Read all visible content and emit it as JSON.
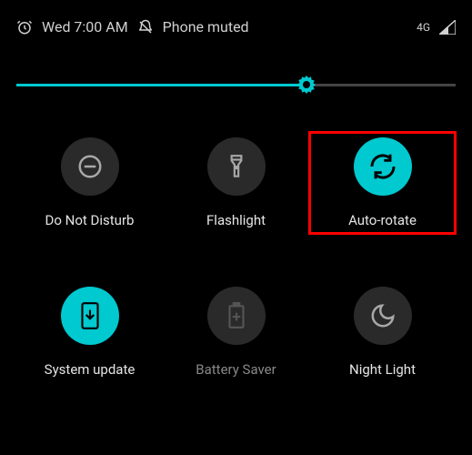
{
  "status": {
    "alarm_time": "Wed 7:00 AM",
    "mute_label": "Phone muted",
    "network": "4G"
  },
  "brightness": {
    "value_percent": 66
  },
  "tiles": [
    {
      "id": "dnd",
      "label": "Do Not Disturb",
      "active": false,
      "highlighted": false
    },
    {
      "id": "flashlight",
      "label": "Flashlight",
      "active": false,
      "highlighted": false
    },
    {
      "id": "auto-rotate",
      "label": "Auto-rotate",
      "active": true,
      "highlighted": true
    },
    {
      "id": "system-update",
      "label": "System update",
      "active": true,
      "highlighted": false
    },
    {
      "id": "battery-saver",
      "label": "Battery Saver",
      "active": false,
      "highlighted": false,
      "dim": true
    },
    {
      "id": "night-light",
      "label": "Night Light",
      "active": false,
      "highlighted": false
    }
  ],
  "colors": {
    "accent": "#00c9d0",
    "highlight": "#ff0000"
  }
}
